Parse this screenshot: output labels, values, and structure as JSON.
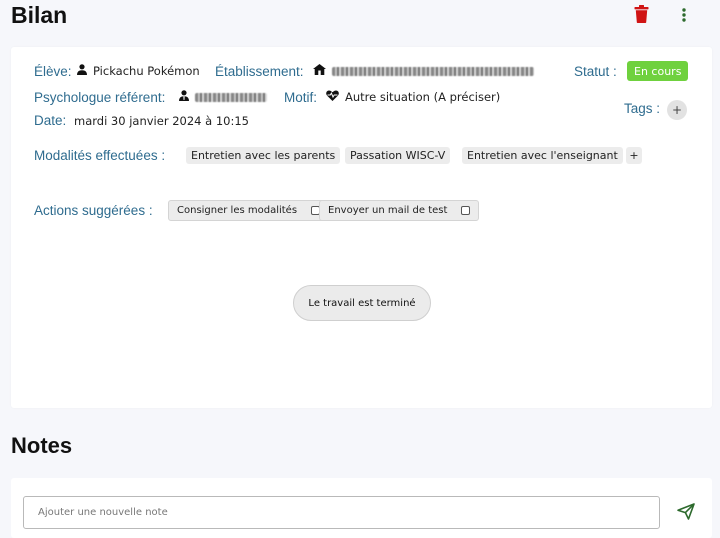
{
  "header": {
    "title": "Bilan",
    "icons": {
      "delete": "trash-icon",
      "menu": "dots-vertical-icon"
    },
    "delete_color": "#d01414",
    "menu_color": "#2d6a2d"
  },
  "bilan": {
    "eleve_label": "Élève:",
    "eleve_value": "Pickachu Pokémon",
    "etablissement_label": "Établissement:",
    "etablissement_value": "",
    "statut_label": "Statut :",
    "statut_value": "En cours",
    "statut_color": "#6fd13e",
    "psychologue_label": "Psychologue référent:",
    "psychologue_value": "",
    "motif_label": "Motif:",
    "motif_value": "Autre situation (A préciser)",
    "tags_label": "Tags :",
    "tags_add_label": "+",
    "date_label": "Date:",
    "date_value": "mardi 30 janvier 2024 à 10:15",
    "modalites_label": "Modalités effectuées :",
    "modalites": [
      {
        "label": "Entretien avec les parents"
      },
      {
        "label": "Passation WISC-V"
      },
      {
        "label": "Entretien avec l'enseignant"
      }
    ],
    "modalites_add_label": "+",
    "actions_label": "Actions suggérées :",
    "actions": [
      {
        "label": "Consigner les modalités",
        "checked": false
      },
      {
        "label": "Envoyer un mail de test",
        "checked": false
      }
    ],
    "done_button_label": "Le travail est terminé",
    "label_color": "#2f6c8f"
  },
  "notes": {
    "title": "Notes",
    "input_placeholder": "Ajouter une nouvelle note",
    "input_value": "",
    "send_icon": "send-icon",
    "send_color": "#2d6a2d"
  }
}
